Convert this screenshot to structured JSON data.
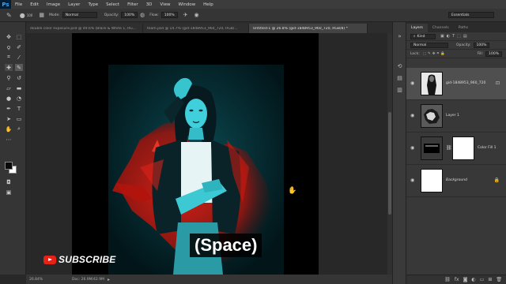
{
  "menubar": {
    "logo": "Ps",
    "items": [
      "File",
      "Edit",
      "Image",
      "Layer",
      "Type",
      "Select",
      "Filter",
      "3D",
      "View",
      "Window",
      "Help"
    ]
  },
  "options": {
    "brush_size": "100",
    "mode_label": "Mode:",
    "mode_value": "Normal",
    "opacity_label": "Opacity:",
    "opacity_value": "100%",
    "flow_label": "Flow:",
    "flow_value": "100%",
    "workspace": "Essentials"
  },
  "tabs": [
    "double color exposure.psd @ 49.6% (Black & White 1, RGB/...",
    "team.psd @ 14.7% (gid-1848953_960_720, RGB/...",
    "Untitled-1 @ 26.8% (gid-1848953_960_720, RGB/8) *"
  ],
  "status": {
    "zoom": "26.84%",
    "doc": "Doc: 26.9M/42.9M"
  },
  "overlay": {
    "subscribe": "SUBSCRIBE",
    "caption": "(Space)"
  },
  "layers_panel": {
    "tabs": [
      "Layers",
      "Channels",
      "Paths"
    ],
    "kind": "Kind",
    "blend_mode": "Normal",
    "opacity_label": "Opacity:",
    "opacity_value": "100%",
    "lock_label": "Lock:",
    "fill_label": "Fill:",
    "fill_value": "100%",
    "layers": [
      {
        "name": "gid-1848953_960_720",
        "selected": true,
        "thumb": "portrait"
      },
      {
        "name": "Layer 1",
        "selected": false,
        "thumb": "wolf"
      },
      {
        "name": "Color Fill 1",
        "selected": false,
        "thumb": "black-white"
      },
      {
        "name": "Background",
        "selected": false,
        "thumb": "white"
      }
    ]
  },
  "colors": {
    "accent_red": "#e62117",
    "cyan_tint": "#3fd0dc",
    "wolf_red": "#c8170f",
    "panel_bg": "#383838"
  }
}
